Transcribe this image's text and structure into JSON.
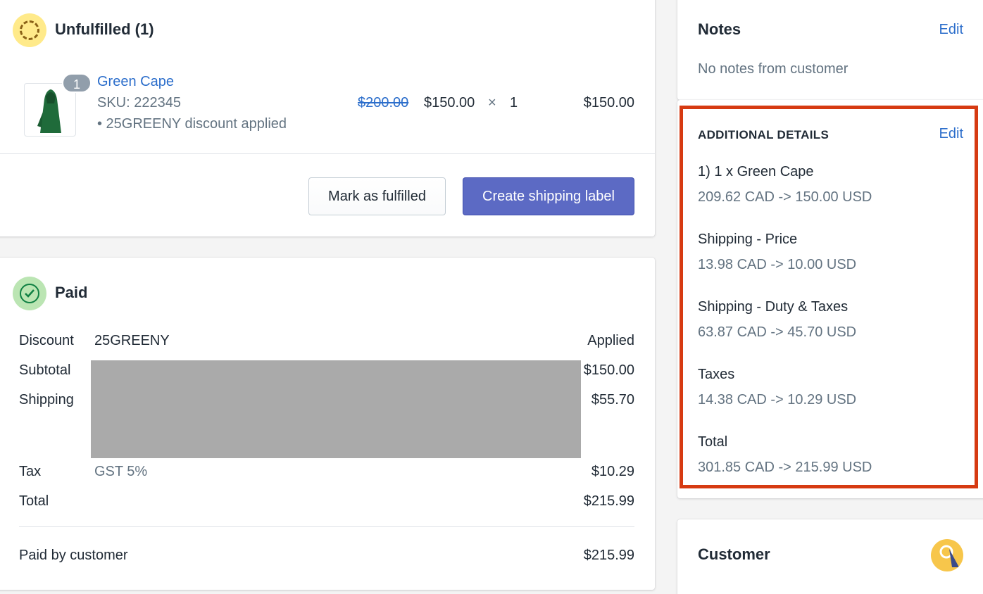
{
  "unfulfilled": {
    "title": "Unfulfilled (1)",
    "item": {
      "quantity_badge": "1",
      "name": "Green Cape",
      "sku": "SKU: 222345",
      "discount_note": "• 25GREENY discount applied",
      "original_price": "$200.00",
      "price": "$150.00",
      "times": "×",
      "quantity": "1",
      "line_total": "$150.00"
    },
    "mark_fulfilled_label": "Mark as fulfilled",
    "create_label_label": "Create shipping label"
  },
  "paid": {
    "title": "Paid",
    "rows": [
      {
        "label": "Discount",
        "detail": "25GREENY",
        "amount": "Applied"
      },
      {
        "label": "Subtotal",
        "detail": "",
        "amount": "$150.00"
      },
      {
        "label": "Shipping",
        "detail": "",
        "amount": "$55.70"
      },
      {
        "label": "Tax",
        "detail": "GST 5%",
        "amount": "$10.29"
      },
      {
        "label": "Total",
        "detail": "",
        "amount": "$215.99"
      }
    ],
    "paid_by_label": "Paid by customer",
    "paid_by_amount": "$215.99"
  },
  "notes": {
    "title": "Notes",
    "edit": "Edit",
    "body": "No notes from customer"
  },
  "additional": {
    "title": "ADDITIONAL DETAILS",
    "edit": "Edit",
    "entries": [
      {
        "label": "1) 1 x Green Cape",
        "value": "209.62 CAD -> 150.00 USD"
      },
      {
        "label": "Shipping - Price",
        "value": "13.98 CAD -> 10.00 USD"
      },
      {
        "label": "Shipping - Duty & Taxes",
        "value": "63.87 CAD -> 45.70 USD"
      },
      {
        "label": "Taxes",
        "value": "14.38 CAD -> 10.29 USD"
      },
      {
        "label": "Total",
        "value": "301.85 CAD -> 215.99 USD"
      }
    ]
  },
  "customer": {
    "title": "Customer"
  },
  "colors": {
    "accent": "#5c6ac4",
    "link": "#2c6ecb",
    "highlight_border": "#d63a12",
    "unfulfilled_badge": "#ffea8a",
    "paid_badge": "#bbe5b3"
  }
}
